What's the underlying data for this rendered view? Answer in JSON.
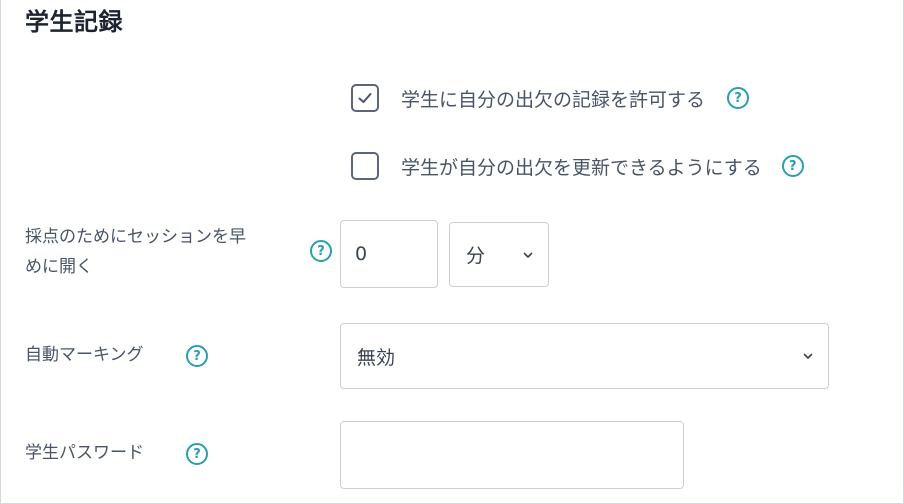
{
  "section": {
    "title": "学生記録"
  },
  "options": [
    {
      "label": "学生に自分の出欠の記録を許可する",
      "checked": true
    },
    {
      "label": "学生が自分の出欠を更新できるようにする",
      "checked": false
    }
  ],
  "open_early": {
    "label_line1": "採点のためにセッションを早",
    "label_line2": "めに開く",
    "value": "0",
    "unit": "分"
  },
  "auto_marking": {
    "label": "自動マーキング",
    "value": "無効"
  },
  "student_password": {
    "label": "学生パスワード",
    "value": ""
  },
  "help_glyph": "?",
  "colors": {
    "accent": "#2a9db0",
    "text": "#495466",
    "border": "#ccd0d5"
  }
}
